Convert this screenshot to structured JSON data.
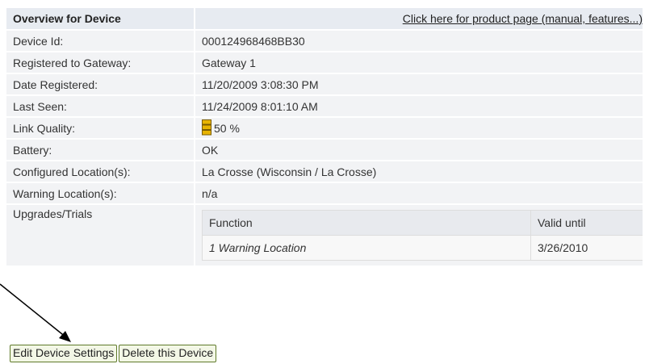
{
  "header": {
    "title": "Overview for Device",
    "product_link": "Click here for product page (manual, features...)"
  },
  "rows": [
    {
      "label": "Device Id:",
      "value": "000124968468BB30"
    },
    {
      "label": "Registered to Gateway:",
      "value": "Gateway 1"
    },
    {
      "label": "Date Registered:",
      "value": "11/20/2009 3:08:30 PM"
    },
    {
      "label": "Last Seen:",
      "value": "11/24/2009 8:01:10 AM"
    },
    {
      "label": "Link Quality:",
      "value": "50 %",
      "icon": "signal-bars-icon",
      "level_percent": 50
    },
    {
      "label": "Battery:",
      "value": "OK"
    },
    {
      "label": "Configured Location(s):",
      "value": "La Crosse (Wisconsin / La Crosse)"
    },
    {
      "label": "Warning Location(s):",
      "value": "n/a"
    }
  ],
  "upgrades": {
    "label": "Upgrades/Trials",
    "columns": [
      "Function",
      "Valid until"
    ],
    "items": [
      {
        "function": "1 Warning Location",
        "valid_until": "3/26/2010"
      }
    ]
  },
  "buttons": {
    "edit": "Edit Device Settings",
    "delete": "Delete this Device"
  },
  "colors": {
    "signal_fill": "#e8b400",
    "button_border": "#5f7a2a",
    "annotation_arrow": "#000000"
  }
}
